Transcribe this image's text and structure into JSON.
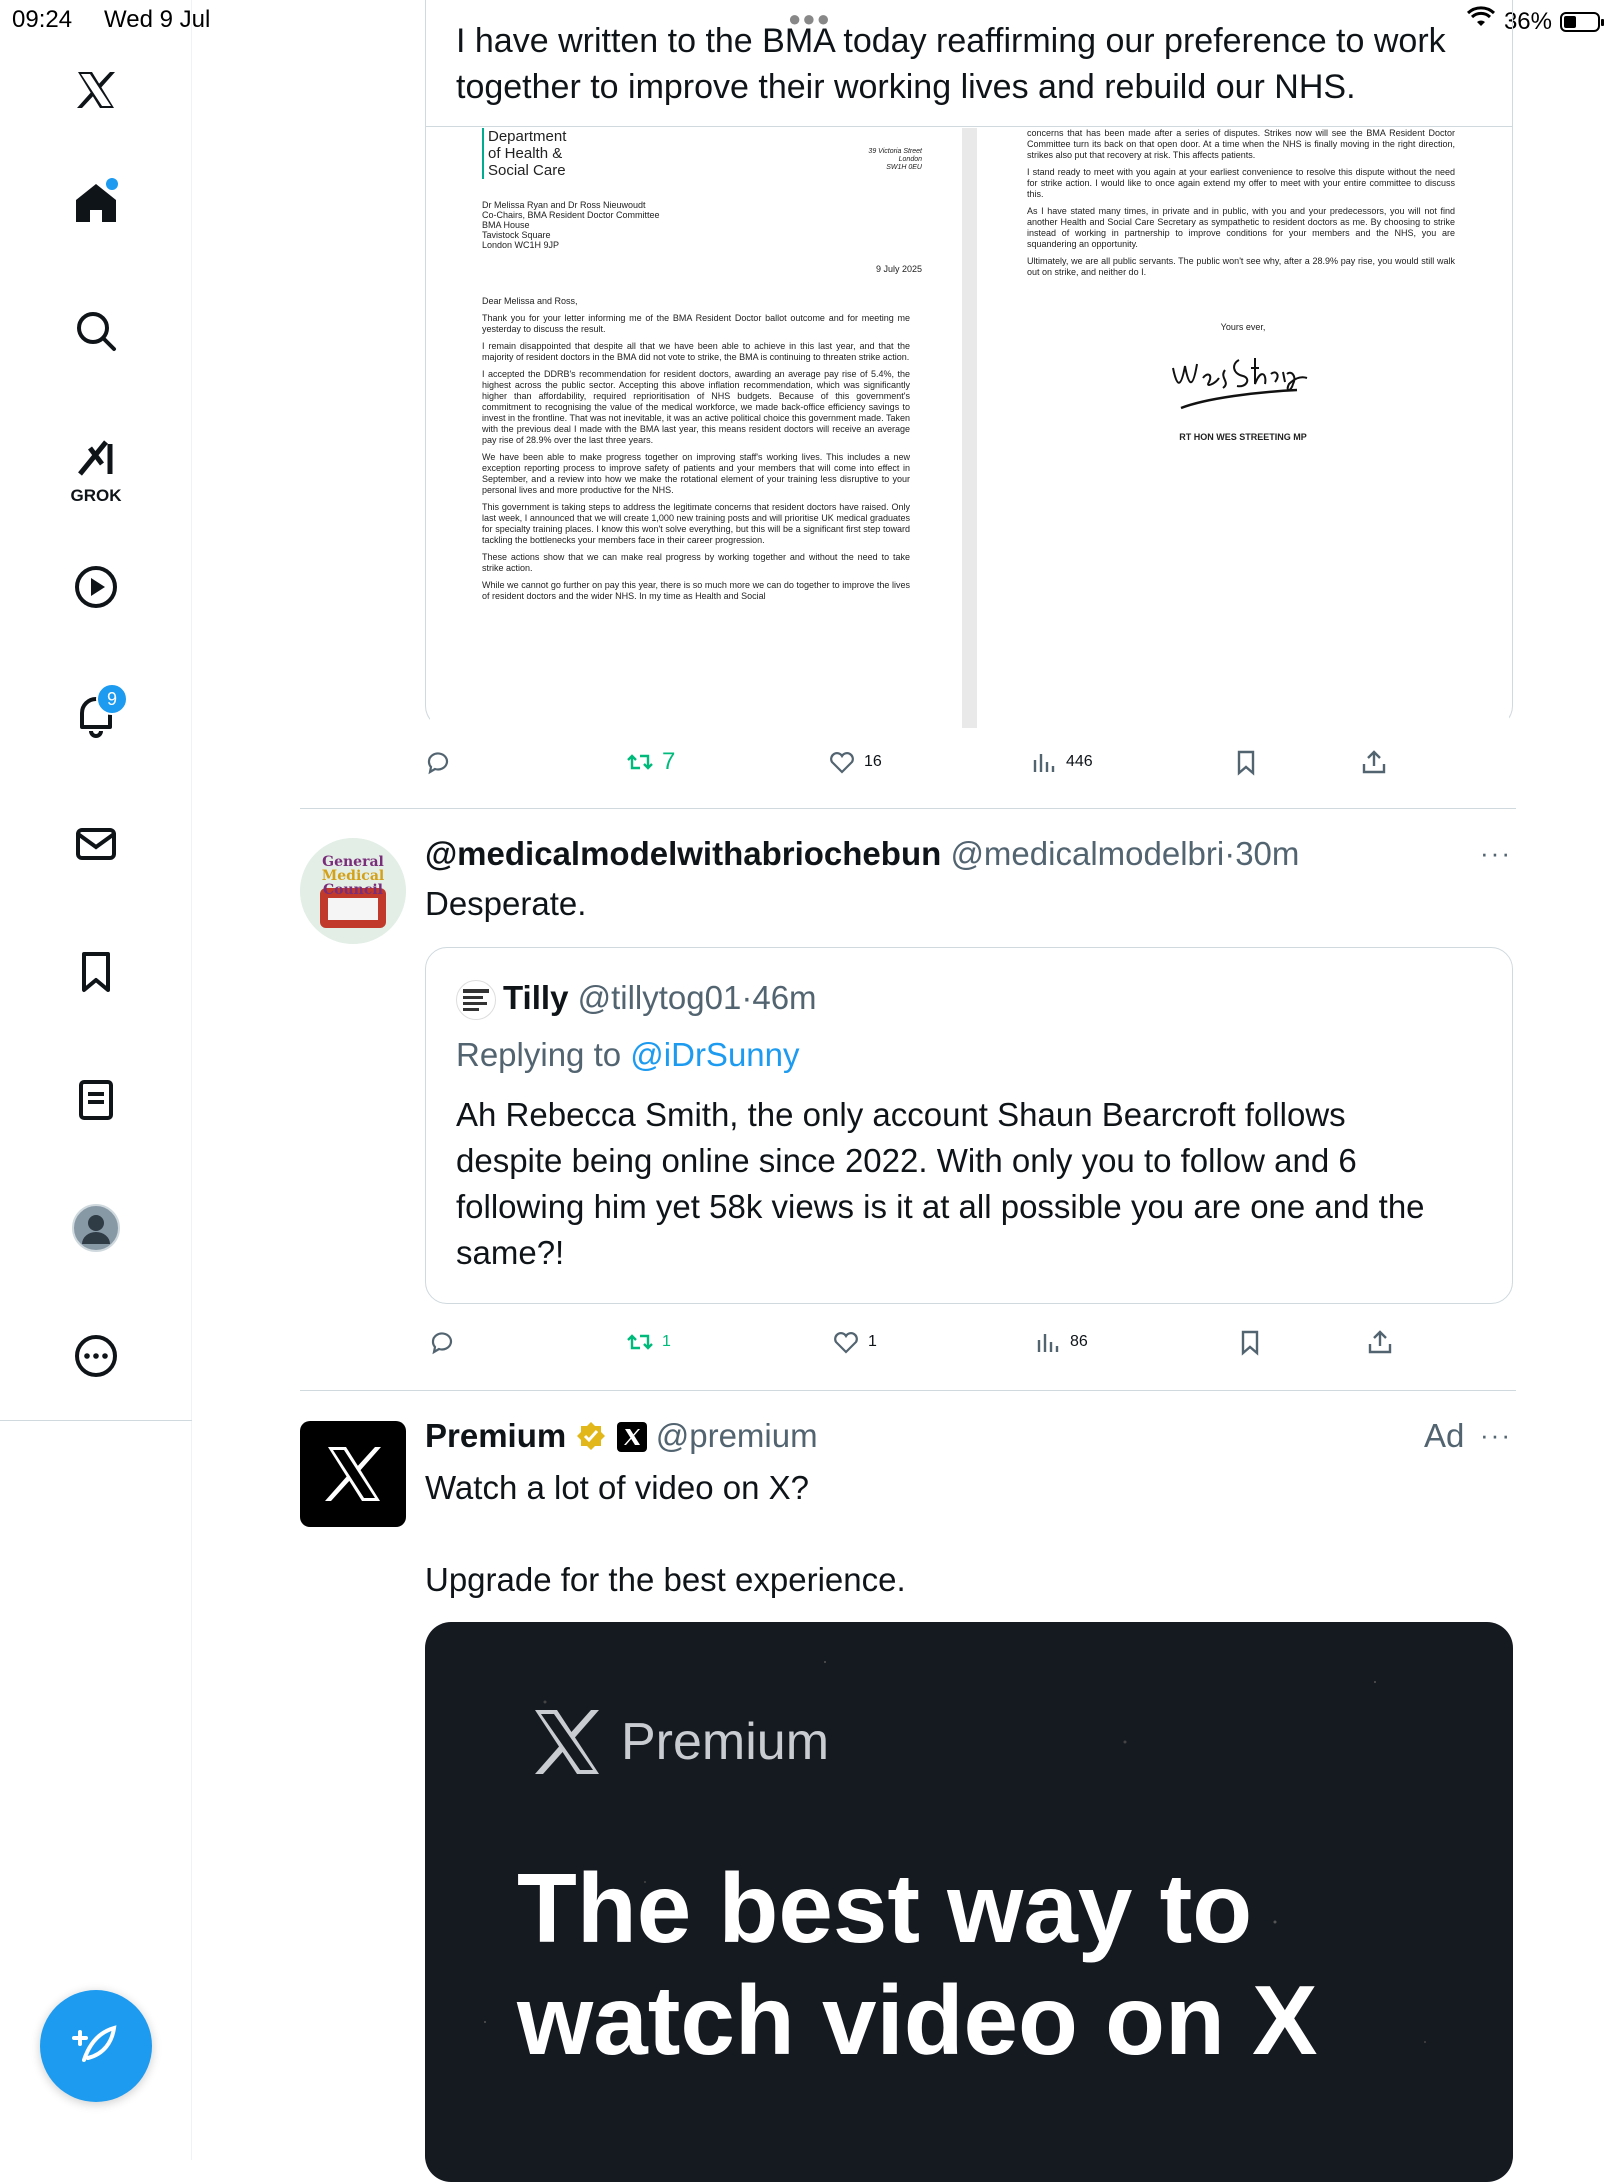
{
  "status_bar": {
    "time": "09:24",
    "date": "Wed 9 Jul",
    "battery": "36%"
  },
  "sidebar": {
    "grok_label": "GROK",
    "notification_count": "9"
  },
  "tweet1": {
    "text_line1": "I have written to the BMA today reaffirming our preference to work",
    "text_line2": "together to improve their working lives and rebuild our NHS.",
    "letter": {
      "dept_line1": "Department",
      "dept_line2": "of Health &",
      "dept_line3": "Social Care",
      "address_line1": "39 Victoria Street",
      "address_line2": "London",
      "address_line3": "SW1H 0EU",
      "recipient_line1": "Dr Melissa Ryan and Dr Ross Nieuwoudt",
      "recipient_line2": "Co-Chairs, BMA Resident Doctor Committee",
      "recipient_line3": "BMA House",
      "recipient_line4": "Tavistock Square",
      "recipient_line5": "London WC1H 9JP",
      "date": "9 July 2025",
      "salutation": "Dear Melissa and Ross,",
      "p1": "Thank you for your letter informing me of the BMA Resident Doctor ballot outcome and for meeting me yesterday to discuss the result.",
      "p2": "I remain disappointed that despite all that we have been able to achieve in this last year, and that the majority of resident doctors in the BMA did not vote to strike, the BMA is continuing to threaten strike action.",
      "p3": "I accepted the DDRB's recommendation for resident doctors, awarding an average pay rise of 5.4%, the highest across the public sector. Accepting this above inflation recommendation, which was significantly higher than affordability, required reprioritisation of NHS budgets. Because of this government's commitment to recognising the value of the medical workforce, we made back-office efficiency savings to invest in the frontline. That was not inevitable, it was an active political choice this government made. Taken with the previous deal I made with the BMA last year, this means resident doctors will receive an average pay rise of 28.9% over the last three years.",
      "p4": "We have been able to make progress together on improving staff's working lives. This includes a new exception reporting process to improve safety of patients and your members that will come into effect in September, and a review into how we make the rotational element of your training less disruptive to your personal lives and more productive for the NHS.",
      "p5": "This government is taking steps to address the legitimate concerns that resident doctors have raised. Only last week, I announced that we will create 1,000 new training posts and will prioritise UK medical graduates for specialty training places. I know this won't solve everything, but this will be a significant first step toward tackling the bottlenecks your members face in their career progression.",
      "p6": "These actions show that we can make real progress by working together and without the need to take strike action.",
      "p7": "While we cannot go further on pay this year, there is so much more we can do together to improve the lives of resident doctors and the wider NHS. In my time as Health and Social",
      "r1": "concerns that has been made after a series of disputes. Strikes now will see the BMA Resident Doctor Committee turn its back on that open door. At a time when the NHS is finally moving in the right direction, strikes also put that recovery at risk. This affects patients.",
      "r2": "I stand ready to meet with you again at your earliest convenience to resolve this dispute without the need for strike action. I would like to once again extend my offer to meet with your entire committee to discuss this.",
      "r3": "As I have stated many times, in private and in public, with you and your predecessors, you will not find another Health and Social Care Secretary as sympathetic to resident doctors as me. By choosing to strike instead of working in partnership to improve conditions for your members and the NHS, you are squandering an opportunity.",
      "r4": "Ultimately, we are all public servants. The public won't see why, after a 28.9% pay rise, you would still walk out on strike, and neither do I.",
      "yours": "Yours ever,",
      "signature": "Wes Streeting",
      "signame": "RT HON WES STREETING MP"
    },
    "retweets": "7",
    "likes": "16",
    "views": "446"
  },
  "tweet2": {
    "name": "@medicalmodelwithabriochebun",
    "handle": "@medicalmodelbri",
    "sep": "·",
    "time": "30m",
    "text": "Desperate.",
    "avatar_text1": "General",
    "avatar_text2": "Medical",
    "avatar_text3": "Council",
    "quote": {
      "name": "Tilly",
      "handle": "@tillytog01",
      "time": "46m",
      "replying_label": "Replying to",
      "replying_to": "@iDrSunny",
      "line1": "Ah Rebecca Smith, the only account Shaun Bearcroft follows",
      "line2": "despite being online since 2022. With only you to follow and 6",
      "line3": "following him yet 58k views is it at all possible you are one and the",
      "line4": "same?!"
    },
    "retweets": "1",
    "likes": "1",
    "views": "86"
  },
  "tweet3": {
    "name": "Premium",
    "handle": "@premium",
    "ad_label": "Ad",
    "text_line1": "Watch a lot of video on X?",
    "text_line2": "Upgrade for the best experience.",
    "media_brand": "Premium",
    "media_headline1": "The best way to",
    "media_headline2": "watch video on X"
  }
}
